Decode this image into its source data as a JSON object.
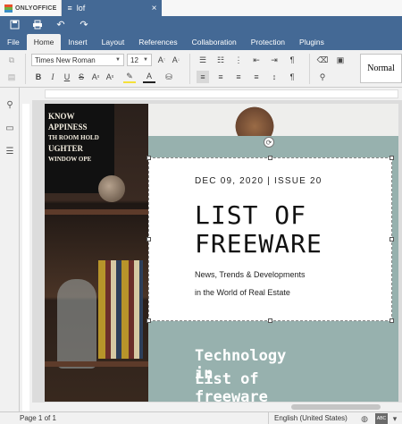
{
  "app": {
    "brand": "ONLYOFFICE",
    "doc_tab": "lof"
  },
  "menu": {
    "tabs": [
      "File",
      "Home",
      "Insert",
      "Layout",
      "References",
      "Collaboration",
      "Protection",
      "Plugins"
    ],
    "active": "Home"
  },
  "ribbon": {
    "font_name": "Times New Roman",
    "font_size": "12",
    "style_preview": "Normal"
  },
  "document": {
    "date_issue": "DEC 09, 2020 | ISSUE 20",
    "title_line1": "LIST OF",
    "title_line2": "FREEWARE",
    "subtitle1": "News, Trends & Developments",
    "subtitle2": "in the World of Real Estate",
    "teal_text1": "Technology",
    "teal_text1b": "in",
    "teal_text2": "List of",
    "teal_text2b": "freeware",
    "photo_sign_lines": [
      "KNOW",
      "APPINESS",
      "TH ROOM HOLD",
      "UGHTER",
      "WINDOW OPE"
    ]
  },
  "status": {
    "page": "Page 1 of 1",
    "language": "English (United States)"
  },
  "colors": {
    "header": "#446995",
    "teal": "#97b1ae"
  }
}
